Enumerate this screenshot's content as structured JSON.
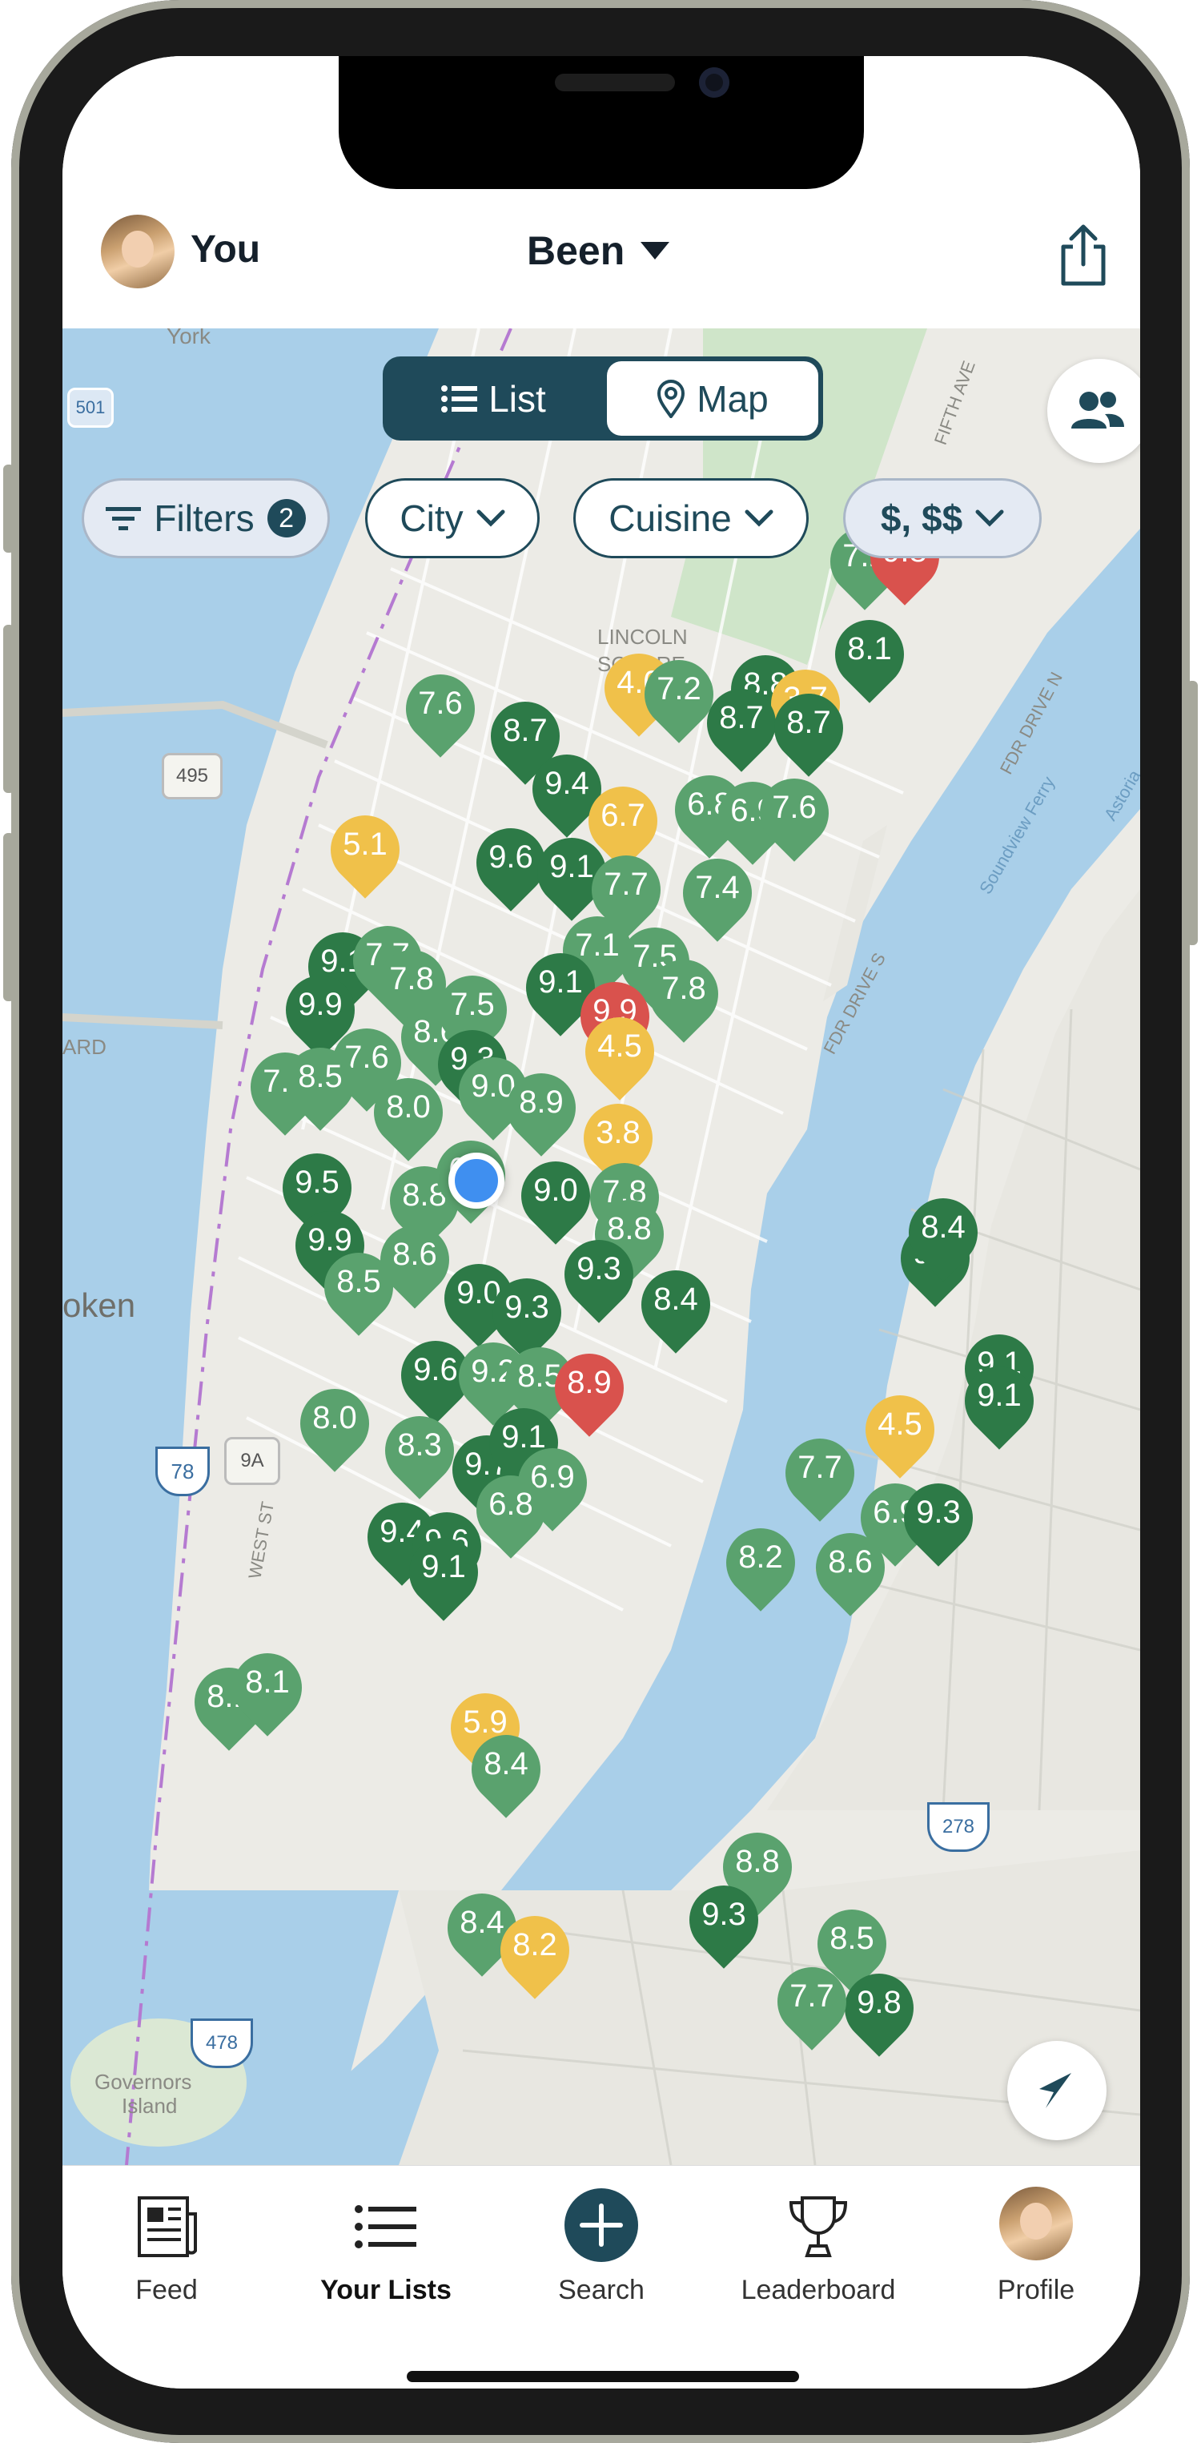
{
  "header": {
    "user_label": "You",
    "list_selector": "Been",
    "avatar_icon": "avatar-photo",
    "share_icon": "share-icon"
  },
  "view_toggle": {
    "list_label": "List",
    "map_label": "Map",
    "active": "Map"
  },
  "filters": {
    "filters_label": "Filters",
    "filters_count": "2",
    "city_label": "City",
    "cuisine_label": "Cuisine",
    "price_label": "$, $$"
  },
  "map_labels": {
    "york": "York",
    "lincoln": "LINCOLN",
    "square": "SQUARE",
    "fifth_ave": "FIFTH AVE",
    "fdr_n": "FDR DRIVE N",
    "fdr_s": "FDR DRIVE S",
    "soundview": "Soundview Ferry",
    "astoria": "Astoria",
    "hoboken": "oken",
    "ward": "ARD",
    "west_st": "WEST ST",
    "governors": "Governors",
    "island": "Island",
    "r501": "501",
    "r495": "495",
    "r78": "78",
    "r9a": "9A",
    "r278": "278",
    "r478": "478"
  },
  "pins": [
    {
      "v": "7.6",
      "c": "g"
    },
    {
      "v": "8.7",
      "c": "dg"
    },
    {
      "v": "9.4",
      "c": "dg"
    },
    {
      "v": "4.0",
      "c": "y"
    },
    {
      "v": "7.2",
      "c": "g"
    },
    {
      "v": "8.8",
      "c": "dg"
    },
    {
      "v": "3.7",
      "c": "y"
    },
    {
      "v": "8.7",
      "c": "dg"
    },
    {
      "v": "8.7",
      "c": "dg"
    },
    {
      "v": "8.1",
      "c": "dg"
    },
    {
      "v": "7.2",
      "c": "g"
    },
    {
      "v": "9.8",
      "c": "r"
    },
    {
      "v": "5.1",
      "c": "y"
    },
    {
      "v": "6.7",
      "c": "y"
    },
    {
      "v": "6.8",
      "c": "g"
    },
    {
      "v": "6.9",
      "c": "g"
    },
    {
      "v": "7.6",
      "c": "g"
    },
    {
      "v": "9.6",
      "c": "dg"
    },
    {
      "v": "9.1",
      "c": "dg"
    },
    {
      "v": "7.7",
      "c": "g"
    },
    {
      "v": "7.4",
      "c": "g"
    },
    {
      "v": "9.1",
      "c": "dg"
    },
    {
      "v": "7.7",
      "c": "g"
    },
    {
      "v": "7.1",
      "c": "g"
    },
    {
      "v": "7.5",
      "c": "g"
    },
    {
      "v": "7.8",
      "c": "g"
    },
    {
      "v": "7.8",
      "c": "g"
    },
    {
      "v": "9.1",
      "c": "dg"
    },
    {
      "v": "9.9",
      "c": "dg"
    },
    {
      "v": "8.6",
      "c": "g"
    },
    {
      "v": "7.5",
      "c": "g"
    },
    {
      "v": "9.9",
      "c": "r"
    },
    {
      "v": "4.5",
      "c": "y"
    },
    {
      "v": "7.6",
      "c": "g"
    },
    {
      "v": "9.3",
      "c": "dg"
    },
    {
      "v": "9.0",
      "c": "g"
    },
    {
      "v": "8.9",
      "c": "g"
    },
    {
      "v": "7.7",
      "c": "g"
    },
    {
      "v": "8.5",
      "c": "g"
    },
    {
      "v": "8.0",
      "c": "g"
    },
    {
      "v": "3.8",
      "c": "y"
    },
    {
      "v": "9.5",
      "c": "dg"
    },
    {
      "v": "8.8",
      "c": "g"
    },
    {
      "v": "6.9",
      "c": "g"
    },
    {
      "v": "9.0",
      "c": "dg"
    },
    {
      "v": "7.8",
      "c": "g"
    },
    {
      "v": "8.8",
      "c": "g"
    },
    {
      "v": "9.9",
      "c": "dg"
    },
    {
      "v": "8.6",
      "c": "g"
    },
    {
      "v": "9.3",
      "c": "dg"
    },
    {
      "v": "8.5",
      "c": "g"
    },
    {
      "v": "9.0",
      "c": "dg"
    },
    {
      "v": "9.3",
      "c": "dg"
    },
    {
      "v": "8.4",
      "c": "dg"
    },
    {
      "v": "9.6",
      "c": "dg"
    },
    {
      "v": "9.2",
      "c": "g"
    },
    {
      "v": "8.5",
      "c": "g"
    },
    {
      "v": "8.9",
      "c": "r"
    },
    {
      "v": "8.0",
      "c": "g"
    },
    {
      "v": "8.3",
      "c": "g"
    },
    {
      "v": "9.7",
      "c": "dg"
    },
    {
      "v": "9.1",
      "c": "dg"
    },
    {
      "v": "6.9",
      "c": "g"
    },
    {
      "v": "9.4",
      "c": "dg"
    },
    {
      "v": "9.6",
      "c": "dg"
    },
    {
      "v": "6.8",
      "c": "g"
    },
    {
      "v": "9.1",
      "c": "dg"
    },
    {
      "v": "8.1",
      "c": "g"
    },
    {
      "v": "9.1",
      "c": "dg"
    },
    {
      "v": "9.4",
      "c": "dg"
    },
    {
      "v": "8.4",
      "c": "dg"
    },
    {
      "v": "9.1",
      "c": "dg"
    },
    {
      "v": "4.5",
      "c": "y"
    },
    {
      "v": "7.7",
      "c": "g"
    },
    {
      "v": "6.9",
      "c": "g"
    },
    {
      "v": "9.3",
      "c": "dg"
    },
    {
      "v": "8.2",
      "c": "g"
    },
    {
      "v": "8.6",
      "c": "g"
    },
    {
      "v": "8.1",
      "c": "g"
    },
    {
      "v": "5.9",
      "c": "y"
    },
    {
      "v": "8.4",
      "c": "g"
    },
    {
      "v": "8.8",
      "c": "g"
    },
    {
      "v": "9.3",
      "c": "dg"
    },
    {
      "v": "8.4",
      "c": "g"
    },
    {
      "v": "8.2",
      "c": "y"
    },
    {
      "v": "8.5",
      "c": "g"
    },
    {
      "v": "9.8",
      "c": "dg"
    },
    {
      "v": "7.7",
      "c": "g"
    }
  ],
  "tabs": [
    {
      "label": "Feed",
      "icon": "newspaper-icon"
    },
    {
      "label": "Your Lists",
      "icon": "list-icon"
    },
    {
      "label": "Search",
      "icon": "plus-icon"
    },
    {
      "label": "Leaderboard",
      "icon": "trophy-icon"
    },
    {
      "label": "Profile",
      "icon": "avatar-photo"
    }
  ],
  "colors": {
    "accent": "#1f4a5a",
    "pin_green": "#5aa26e",
    "pin_dark_green": "#2d7a47",
    "pin_yellow": "#f0c14a",
    "pin_red": "#d9524d",
    "water": "#a9cfe9",
    "land": "#ecebe6",
    "park": "#cfe5c9"
  }
}
